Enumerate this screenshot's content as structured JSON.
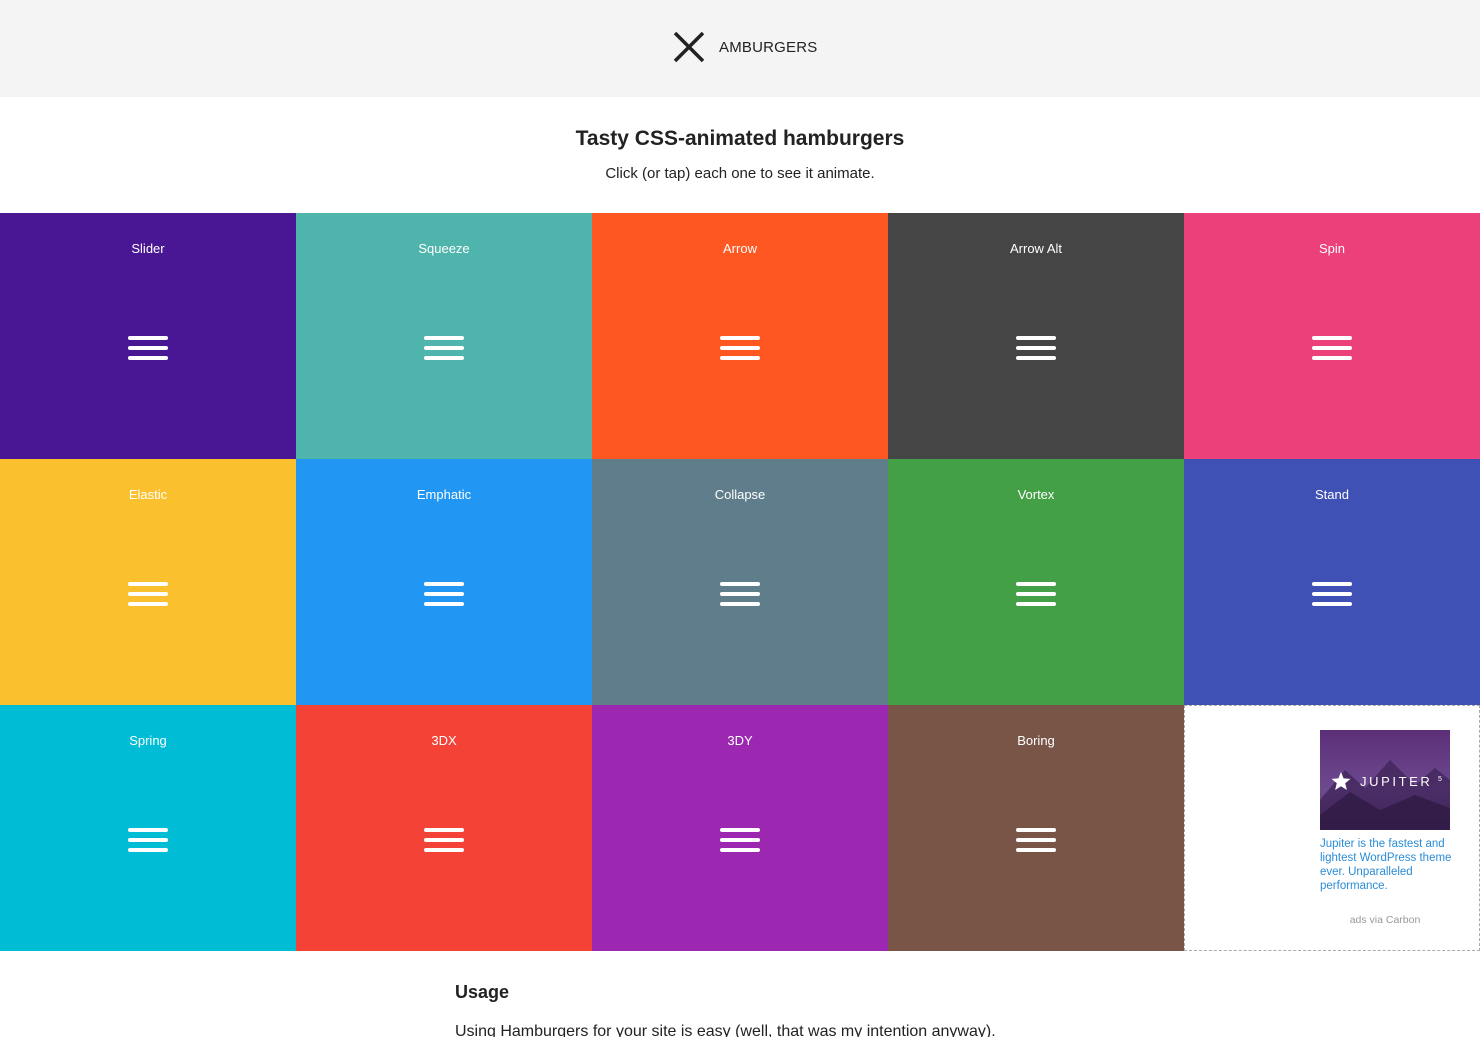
{
  "header": {
    "logo_icon": "x-close-icon",
    "logo_text": "AMBURGERS"
  },
  "intro": {
    "title": "Tasty CSS-animated hamburgers",
    "subtitle": "Click (or tap) each one to see it animate."
  },
  "tiles": [
    {
      "label": "Slider",
      "color": "#491793"
    },
    {
      "label": "Squeeze",
      "color": "#4fb5ac"
    },
    {
      "label": "Arrow",
      "color": "#fe5722"
    },
    {
      "label": "Arrow Alt",
      "color": "#454545"
    },
    {
      "label": "Spin",
      "color": "#ec407a"
    },
    {
      "label": "Elastic",
      "color": "#fbc02d"
    },
    {
      "label": "Emphatic",
      "color": "#2196f3"
    },
    {
      "label": "Collapse",
      "color": "#607d8b"
    },
    {
      "label": "Vortex",
      "color": "#43a047"
    },
    {
      "label": "Stand",
      "color": "#3f51b5"
    },
    {
      "label": "Spring",
      "color": "#00bcd4"
    },
    {
      "label": "3DX",
      "color": "#f44336"
    },
    {
      "label": "3DY",
      "color": "#9c27b0"
    },
    {
      "label": "Boring",
      "color": "#795548"
    }
  ],
  "ad": {
    "image_brand": "JUPITER",
    "image_superscript": "5",
    "text": "Jupiter is the fastest and lightest WordPress theme ever. Unparalleled performance.",
    "via": "ads via Carbon"
  },
  "usage": {
    "heading": "Usage",
    "text": "Using Hamburgers for your site is easy (well, that was my intention anyway)."
  }
}
